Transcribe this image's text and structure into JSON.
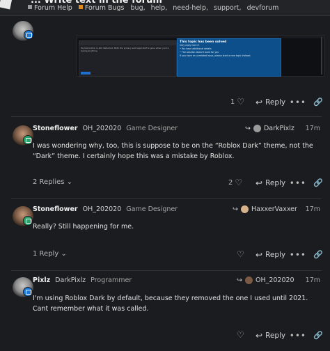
{
  "header": {
    "title_fragment": "... Write text in the forum",
    "categories": [
      {
        "label": "Forum Help",
        "color": "#9a9a9a"
      },
      {
        "label": "Forum Bugs",
        "color": "#e08b1a"
      }
    ],
    "tags": [
      "bug,",
      "help,",
      "need-help,",
      "support,",
      "devforum"
    ]
  },
  "embed": {
    "panel_title": "This topic has been solved",
    "panel_lines": [
      "Only reply here if:",
      "• You have additional details",
      "• The solution doesn't work for you",
      "If you have an unrelated issue, please start a new topic instead."
    ],
    "compose_text": "My like button is still disturbed. Both the privacy and legal stuff is gone when you're typing anything"
  },
  "first_post_actions": {
    "likes": "1",
    "reply_label": "Reply"
  },
  "posts": [
    {
      "username": "Stoneflower",
      "full_name": "OH_202020",
      "user_title": "Game Designer",
      "reply_to": "DarkPixlz",
      "date": "17m",
      "body": "I was wondering why, too, this is suppose to be on the “Roblox Dark” theme, not the “Dark” theme. I certainly hope this was a mistake by Roblox.",
      "replies": "2 Replies",
      "likes": "2",
      "reply_label": "Reply"
    },
    {
      "username": "Stoneflower",
      "full_name": "OH_202020",
      "user_title": "Game Designer",
      "reply_to": "HaxxerVaxxer",
      "date": "17m",
      "body": "Really? Still happening for me.",
      "replies": "1 Reply",
      "likes": "",
      "reply_label": "Reply"
    },
    {
      "username": "Pixlz",
      "full_name": "DarkPixlz",
      "user_title": "Programmer",
      "reply_to": "OH_202020",
      "date": "17m",
      "body": "I'm using Roblox Dark by default, because they removed the one I used until 2021. Cant remember what it was called.",
      "replies": "",
      "likes": "",
      "reply_label": "Reply"
    }
  ],
  "colors": {
    "background": "#1b1c1f",
    "badge_blue": "#1b78d6",
    "badge_green": "#29a36a"
  }
}
